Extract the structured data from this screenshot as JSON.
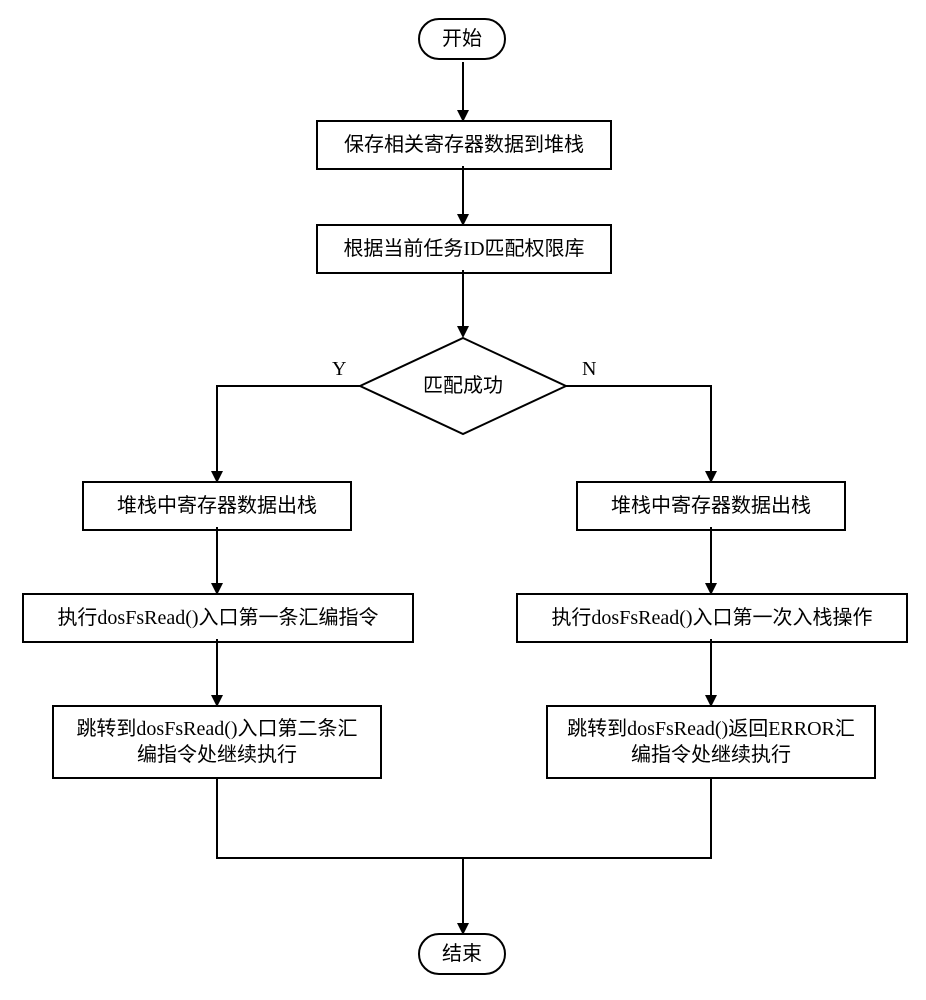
{
  "nodes": {
    "start": "开始",
    "step1": "保存相关寄存器数据到堆栈",
    "step2": "根据当前任务ID匹配权限库",
    "decision": "匹配成功",
    "yes_label": "Y",
    "no_label": "N",
    "left1": "堆栈中寄存器数据出栈",
    "left2": "执行dosFsRead()入口第一条汇编指令",
    "left3": "跳转到dosFsRead()入口第二条汇编指令处继续执行",
    "right1": "堆栈中寄存器数据出栈",
    "right2": "执行dosFsRead()入口第一次入栈操作",
    "right3": "跳转到dosFsRead()返回ERROR汇编指令处继续执行",
    "end": "结束"
  }
}
